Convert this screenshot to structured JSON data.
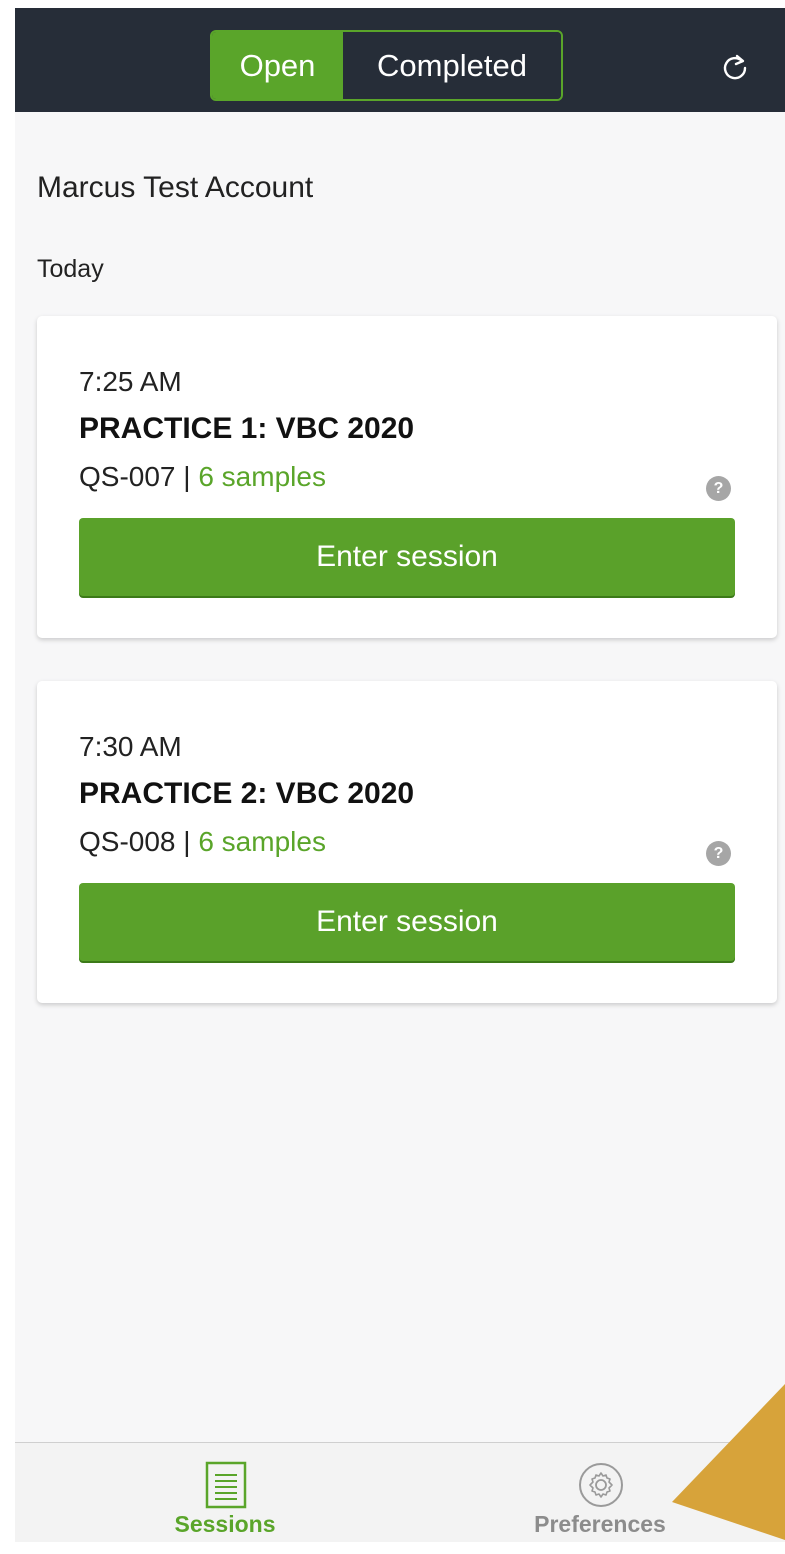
{
  "header": {
    "segments": {
      "open": "Open",
      "completed": "Completed"
    },
    "refresh_icon": "refresh-icon"
  },
  "account_name": "Marcus Test Account",
  "day_label": "Today",
  "sessions": [
    {
      "time": "7:25 AM",
      "title": "PRACTICE 1: VBC 2020",
      "code": "QS-007 | ",
      "samples": "6 samples",
      "help": "?",
      "button": "Enter session"
    },
    {
      "time": "7:30 AM",
      "title": "PRACTICE 2: VBC 2020",
      "code": "QS-008 | ",
      "samples": "6 samples",
      "help": "?",
      "button": "Enter session"
    }
  ],
  "tabbar": {
    "sessions": "Sessions",
    "preferences": "Preferences"
  },
  "colors": {
    "accent": "#5aa52a",
    "header_bg": "#262d38",
    "annotation": "#d7a33a"
  }
}
